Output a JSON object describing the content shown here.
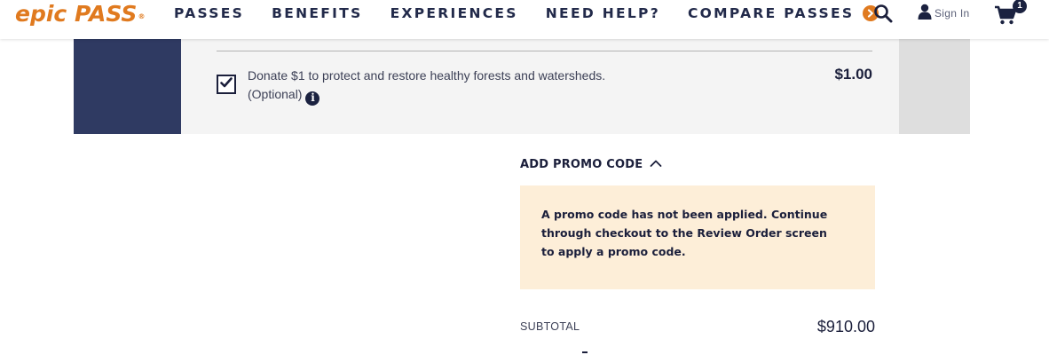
{
  "header": {
    "logo_text": "epic PASS",
    "logo_mark": "®",
    "nav": [
      {
        "label": "PASSES"
      },
      {
        "label": "BENEFITS"
      },
      {
        "label": "EXPERIENCES"
      },
      {
        "label": "NEED HELP?"
      },
      {
        "label": "COMPARE PASSES"
      }
    ],
    "sign_in_label": "Sign In",
    "cart_count": "1",
    "icons": {
      "search": "search-icon",
      "user": "user-icon",
      "cart": "cart-icon",
      "nav_arrow": "chevron-right-circle-icon"
    }
  },
  "donation": {
    "checked": true,
    "line1": "Donate $1 to protect and restore healthy forests and watersheds.",
    "line2": "(Optional)",
    "price": "$1.00"
  },
  "promo": {
    "toggle_label": "ADD PROMO CODE",
    "notice": "A promo code has not been applied. Continue through checkout to the Review Order screen to apply a promo code."
  },
  "totals": {
    "subtotal_label": "SUBTOTAL",
    "subtotal_value": "$910.00"
  },
  "colors": {
    "brand_orange": "#e07a1f",
    "navy": "#1b2240",
    "band_navy": "#2f3a62",
    "notice_bg": "#fdeed8"
  }
}
